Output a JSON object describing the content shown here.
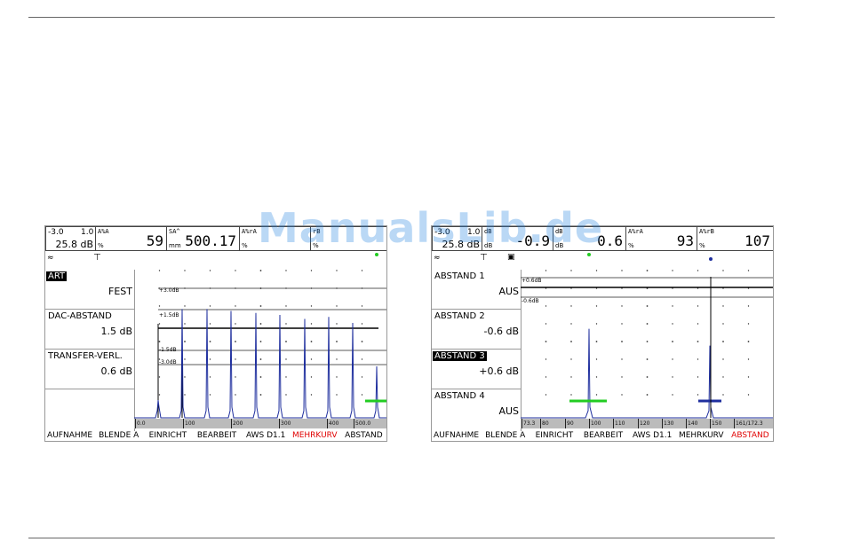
{
  "watermark": "ManualsLib.de",
  "left": {
    "gain": {
      "val1": "-3.0",
      "val2": "1.0",
      "main": "25.8 dB"
    },
    "readings": [
      {
        "label": "A%A",
        "unit": "%",
        "value": "59"
      },
      {
        "label": "SA^",
        "unit": "mm",
        "value": "500.17"
      },
      {
        "label": "A%rA",
        "unit": "%",
        "value": ""
      },
      {
        "label": "rB",
        "unit": "%",
        "value": ""
      }
    ],
    "menu": [
      {
        "label": "ART",
        "value": "FEST",
        "selected": true
      },
      {
        "label": "DAC-ABSTAND",
        "value": "1.5 dB",
        "selected": false
      },
      {
        "label": "TRANSFER-VERL.",
        "value": "0.6 dB",
        "selected": false
      },
      {
        "label": "",
        "value": "",
        "selected": false
      }
    ],
    "curve_labels": [
      "+3.0dB",
      "+1.5dB",
      "-1.5dB",
      "-3.0dB"
    ],
    "scale": [
      "0.0",
      "100",
      "200",
      "300",
      "400",
      "500.0"
    ],
    "footer": [
      "AUFNAHME",
      "BLENDE A",
      "EINRICHT",
      "BEARBEIT",
      "AWS D1.1",
      "MEHRKURV",
      "ABSTAND"
    ],
    "active_footer": 5,
    "peak_levels": [
      0.0,
      0.92,
      0.92,
      0.9,
      0.88,
      0.86,
      0.82,
      0.84,
      0.78,
      0.34
    ]
  },
  "right": {
    "gain": {
      "val1": "-3.0",
      "val2": "1.0",
      "main": "25.8 dB"
    },
    "readings": [
      {
        "label": "dB",
        "unit": "dB",
        "value": "-0.9"
      },
      {
        "label": "dB",
        "unit": "dB",
        "value": "0.6"
      },
      {
        "label": "A%rA",
        "unit": "%",
        "value": "93"
      },
      {
        "label": "A%rB",
        "unit": "%",
        "value": "107"
      }
    ],
    "menu": [
      {
        "label": "ABSTAND 1",
        "value": "AUS",
        "selected": false
      },
      {
        "label": "ABSTAND 2",
        "value": "-0.6 dB",
        "selected": false
      },
      {
        "label": "ABSTAND 3",
        "value": "+0.6 dB",
        "selected": true
      },
      {
        "label": "ABSTAND 4",
        "value": "AUS",
        "selected": false
      }
    ],
    "curve_labels": [
      "+0.6dB",
      "-0.6dB"
    ],
    "scale": [
      "73.3",
      "80",
      "90",
      "100",
      "110",
      "120",
      "130",
      "140",
      "150",
      "161/172.3"
    ],
    "footer": [
      "AUFNAHME",
      "BLENDE A",
      "EINRICHT",
      "BEARBEIT",
      "AWS D1.1",
      "MEHRKURV",
      "ABSTAND"
    ],
    "active_footer": 6,
    "peak_levels": [
      0.72,
      0.55
    ]
  },
  "colors": {
    "echo": "#1f2f9e",
    "gate_a": "#22cc22",
    "gate_b": "#1f2f9e",
    "active": "#e00000"
  }
}
